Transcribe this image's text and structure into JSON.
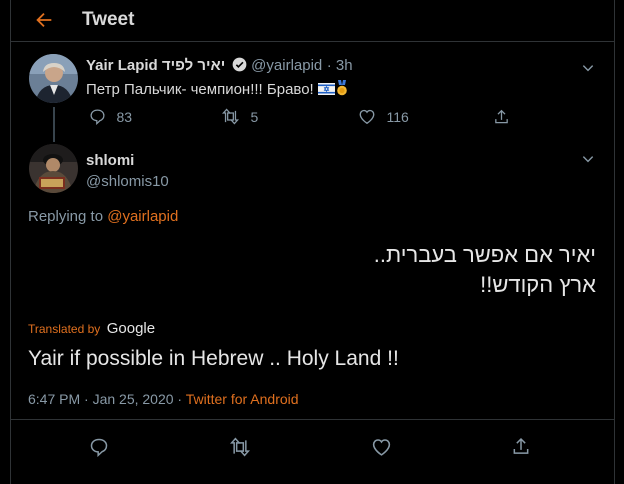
{
  "header": {
    "title": "Tweet"
  },
  "parent_tweet": {
    "name": "Yair Lapid יאיר לפיד",
    "handle": "@yairlapid",
    "time": "· 3h",
    "text": "Петр Пальчик- чемпион!!! Браво!",
    "replies": "83",
    "retweets": "5",
    "likes": "116"
  },
  "main_tweet": {
    "name": "shlomi",
    "handle": "@shlomis10",
    "replying_prefix": "Replying to",
    "replying_to": "@yairlapid",
    "text_line1": "יאיר אם אפשר בעברית..",
    "text_line2": "ארץ הקודש!!",
    "translated_by": "Translated by",
    "translator": "Google",
    "translation": "Yair if possible in Hebrew .. Holy Land !!",
    "date": "6:47 PM · Jan 25, 2020 ·",
    "source": "Twitter for Android"
  },
  "colors": {
    "accent": "#e0701f",
    "muted": "#8899a6",
    "text": "#d9d9d9",
    "background": "#000000"
  }
}
